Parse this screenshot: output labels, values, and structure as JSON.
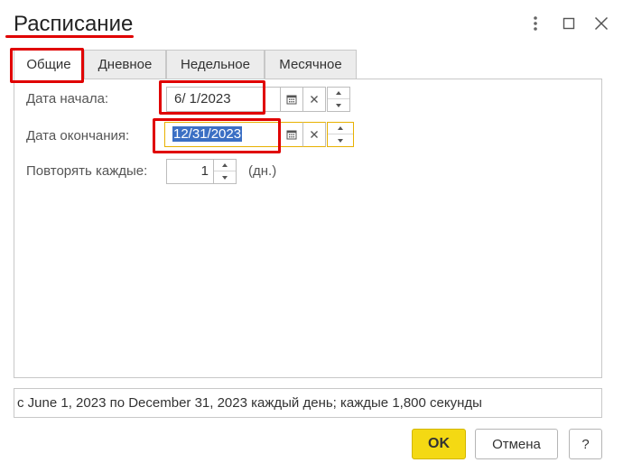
{
  "window": {
    "title": "Расписание",
    "icons": {
      "more": "vertical-dots-icon",
      "maximize": "maximize-icon",
      "close": "close-icon"
    }
  },
  "tabs": [
    {
      "label": "Общие",
      "active": true
    },
    {
      "label": "Дневное",
      "active": false
    },
    {
      "label": "Недельное",
      "active": false
    },
    {
      "label": "Месячное",
      "active": false
    }
  ],
  "fields": {
    "start_date": {
      "label": "Дата начала:",
      "value": "6/ 1/2023"
    },
    "end_date": {
      "label": "Дата окончания:",
      "value": "12/31/2023"
    },
    "repeat": {
      "label": "Повторять каждые:",
      "value": "1",
      "unit": "(дн.)"
    }
  },
  "summary": "с June 1, 2023 по December 31, 2023 каждый день; каждые 1,800 секунды",
  "buttons": {
    "ok": "OK",
    "cancel": "Отмена",
    "help": "?"
  },
  "colors": {
    "accent": "#f4d913",
    "highlight": "#e00000",
    "focus": "#e8b100",
    "selection": "#3b6fc4"
  }
}
